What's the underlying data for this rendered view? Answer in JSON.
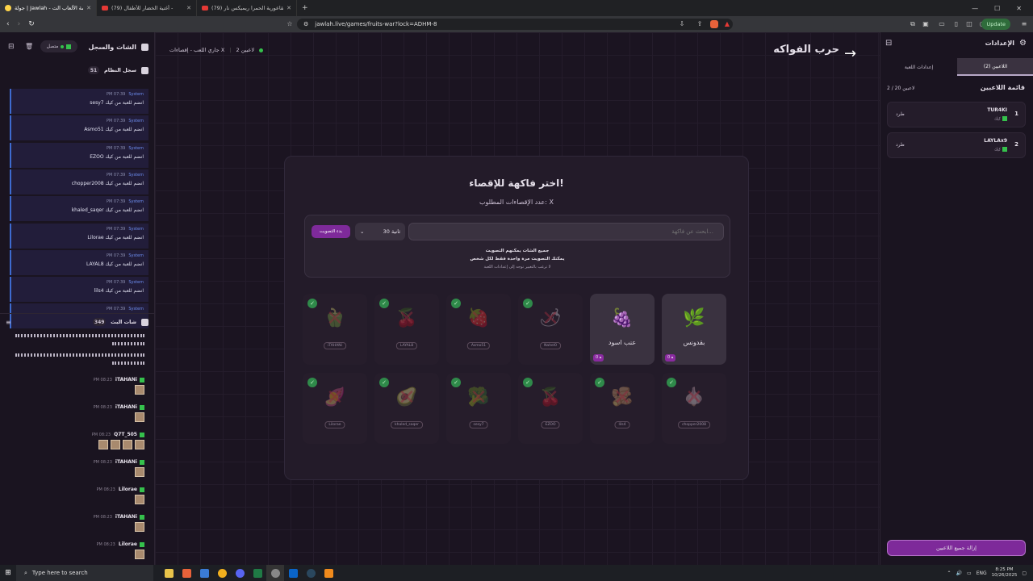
{
  "browser": {
    "tabs": [
      {
        "label": "جولة | Jawlah - منصة الألعاب الت...",
        "active": true
      },
      {
        "label": "(79) أغنية الخضار للأطفال -",
        "active": false
      },
      {
        "label": "(79) انا القاعورية الحمرا ريميكس نار",
        "active": false
      }
    ],
    "url": "jawlah.live/games/fruits-war?lock=ADHM-8",
    "update_label": "Update"
  },
  "left_panel": {
    "title": "الشات والسجل",
    "connection": "متصل",
    "system_log_title": "سجل النظام",
    "system_log_count": "51",
    "system_items": [
      {
        "sender": "System",
        "time": "PM 07:39",
        "msg": "sesy7 انضم للعبة من كيك"
      },
      {
        "sender": "System",
        "time": "PM 07:39",
        "msg": "Asmo51 انضم للعبة من كيك"
      },
      {
        "sender": "System",
        "time": "PM 07:39",
        "msg": "EZOO انضم للعبة من كيك"
      },
      {
        "sender": "System",
        "time": "PM 07:39",
        "msg": "chopper2008 انضم للعبة من كيك"
      },
      {
        "sender": "System",
        "time": "PM 07:39",
        "msg": "khaled_saqer انضم للعبة من كيك"
      },
      {
        "sender": "System",
        "time": "PM 07:39",
        "msg": "Lilorae انضم للعبة من كيك"
      },
      {
        "sender": "System",
        "time": "PM 07:39",
        "msg": "LAYAL8 انضم للعبة من كيك"
      },
      {
        "sender": "System",
        "time": "PM 07:39",
        "msg": "lils4 انضم للعبة من كيك"
      },
      {
        "sender": "System",
        "time": "PM 07:39",
        "msg": ""
      }
    ],
    "live_chat_title": "شات البث",
    "live_chat_count": "349",
    "chat_messages": [
      {
        "name": "iTAHANi",
        "time": "PM 08:23",
        "emotes": 1
      },
      {
        "name": "iTAHANi",
        "time": "PM 08:23",
        "emotes": 1
      },
      {
        "name": "Q7T_505",
        "time": "PM 08:23",
        "emotes": 4
      },
      {
        "name": "iTAHANi",
        "time": "PM 08:23",
        "emotes": 1
      },
      {
        "name": "Lilorae",
        "time": "PM 08:23",
        "emotes": 1
      },
      {
        "name": "iTAHANi",
        "time": "PM 08:23",
        "emotes": 1
      },
      {
        "name": "Lilorae",
        "time": "PM 08:23",
        "emotes": 1
      }
    ]
  },
  "center": {
    "game_title": "حرب الفواكه",
    "status": {
      "players": "2 لاعبين",
      "phase": "جاري اللعب - إقصاءات X"
    },
    "card_title": "اختر فاكهة للإقصاء!",
    "card_subtitle": "عدد الإقصاءات المطلوب: X",
    "search_placeholder": "ابحث عن فاكهة...",
    "time_select": "30 ثانية",
    "start_vote": "بدء التصويت",
    "info_1": "جميع الشات يمكنهم التصويت",
    "info_2": "يمكنك التصويت مرة واحدة فقط لكل شخص",
    "info_3": "لا ترغب بالتغيير توجه إلى إعدادات اللعبة",
    "fruits_row1": [
      {
        "name": "بقدونس",
        "emoji": "🌿",
        "state": "active",
        "votes": "0"
      },
      {
        "name": "عنب اسود",
        "emoji": "🍇",
        "state": "active",
        "votes": "0"
      },
      {
        "owner": "Nahel0",
        "emoji": "🌶",
        "state": "elim"
      },
      {
        "owner": "Asmo51",
        "emoji": "🍓",
        "state": "elim"
      },
      {
        "owner": "LAYAL8",
        "emoji": "🍒",
        "state": "elim"
      },
      {
        "owner": "iTAHANi",
        "emoji": "🫑",
        "state": "elim"
      }
    ],
    "fruits_row2": [
      {
        "owner": "chopper2008",
        "emoji": "🧄",
        "state": "elim"
      },
      {
        "owner": "lils4",
        "emoji": "🫚",
        "state": "elim"
      },
      {
        "owner": "EZOO",
        "emoji": "🍒",
        "state": "elim"
      },
      {
        "owner": "sesy7",
        "emoji": "🥦",
        "state": "elim"
      },
      {
        "owner": "khaled_saqer",
        "emoji": "🥑",
        "state": "elim"
      },
      {
        "owner": "Lilorae",
        "emoji": "🍠",
        "state": "elim"
      }
    ]
  },
  "right_panel": {
    "title": "الإعدادات",
    "tab_players": "اللاعبين (2)",
    "tab_settings": "إعدادات اللعبة",
    "list_title": "قائمة اللاعبين",
    "list_count": "2 / 20 لاعبين",
    "players": [
      {
        "num": "1",
        "name": "TUR4KI",
        "platform": "كيك",
        "action": "طرد"
      },
      {
        "num": "2",
        "name": "LAYLAx9",
        "platform": "كيك",
        "action": "طرد"
      }
    ],
    "remove_all": "إزالة جميع اللاعبين"
  },
  "taskbar": {
    "search_placeholder": "Type here to search",
    "lang": "ENG",
    "time": "8:25 PM",
    "date": "10/26/2025"
  }
}
